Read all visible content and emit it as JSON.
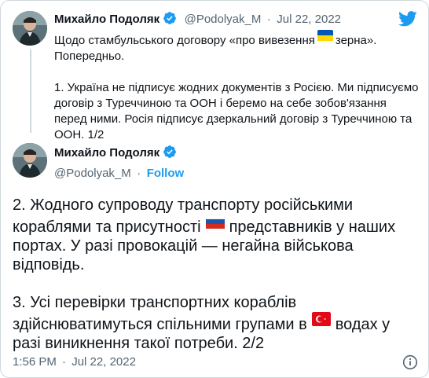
{
  "quoted_tweet": {
    "author_name": "Михайло Подоляк",
    "handle": "@Podolyak_M",
    "separator": "·",
    "date": "Jul 22, 2022",
    "text_line1_before_flag": "Щодо стамбульського договору «про вивезення",
    "flag_ua": "flag-ukraine-icon",
    "text_line1_after_flag": "зерна».",
    "text_line2": "Попередньо.",
    "para1_line1": "1. Україна не підписує жодних документів з Росією. Ми підписуємо",
    "para1_line2": "договір з Туреччиною та ООН і беремо на себе зобов'язання",
    "para1_line3": "перед ними. Росія підписує дзеркальний договір з Туреччиною та",
    "para1_line4": "ООН. 1/2"
  },
  "main_tweet": {
    "author_name": "Михайло Подоляк",
    "handle": "@Podolyak_M",
    "separator": "·",
    "follow_label": "Follow",
    "p1_line1": "2. Жодного супроводу транспорту російськими",
    "p1_line2_before_flag": "кораблями та присутності",
    "p1_line2_after_flag": "представників у наших",
    "p1_line3": "портах. У разі провокацій — негайна військова",
    "p1_line4": "відповідь.",
    "p2_line1": "3. Усі перевірки транспортних кораблів",
    "p2_line2_before_flag": "здійснюватимуться спільними групами в",
    "p2_line2_after_flag": "водах у",
    "p2_line3": "разі виникнення такої потреби. 2/2",
    "flag_ru": "flag-russia-icon",
    "flag_tr": "flag-turkey-icon"
  },
  "footer": {
    "time": "1:56 PM",
    "separator": "·",
    "date": "Jul 22, 2022",
    "info_icon": "info-icon"
  },
  "colors": {
    "twitter_blue": "#1d9bf0",
    "text": "#0f1419",
    "muted": "#536471",
    "border": "#cfd9de"
  },
  "icons": {
    "logo": "twitter-bird-icon",
    "verified": "verified-badge-icon"
  }
}
